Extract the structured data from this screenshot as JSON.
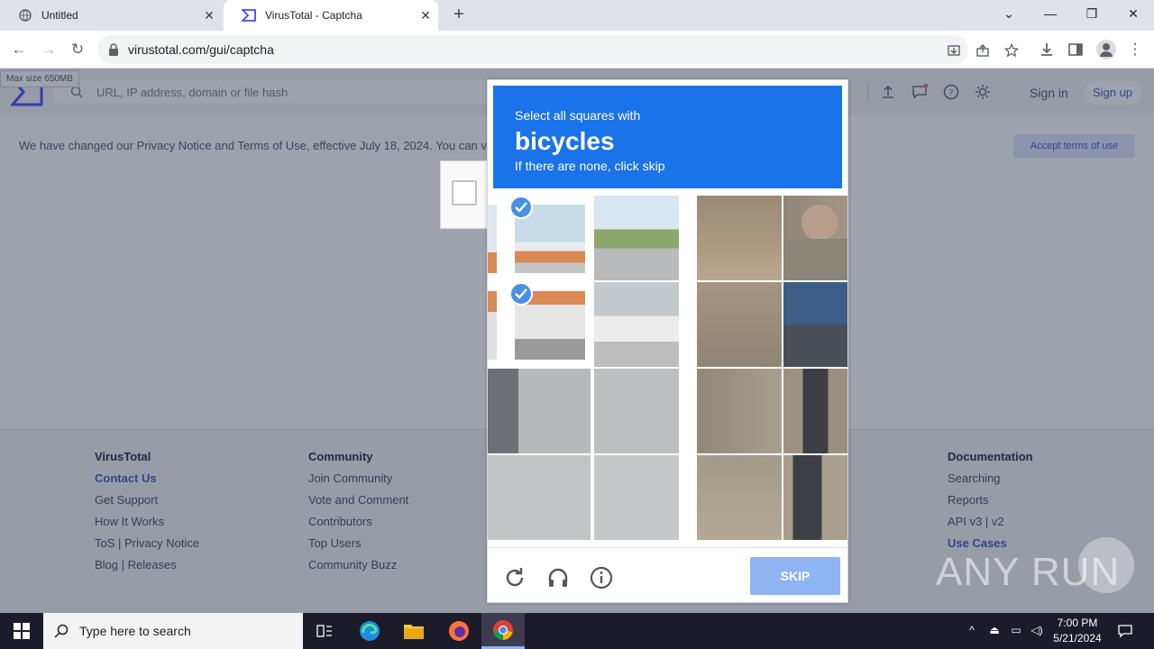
{
  "browser": {
    "tabs": [
      {
        "title": "Untitled",
        "active": false
      },
      {
        "title": "VirusTotal - Captcha",
        "active": true
      }
    ],
    "url": "virustotal.com/gui/captcha"
  },
  "page": {
    "max_size_tooltip": "Max size 650MB",
    "search_placeholder": "URL, IP address, domain or file hash",
    "sign_in": "Sign in",
    "sign_up": "Sign up",
    "banner_text": "We have changed our Privacy Notice and Terms of Use, effective July 18, 2024. You can v",
    "accept_terms": "Accept terms of use",
    "footer": {
      "col1": {
        "title": "VirusTotal",
        "links": [
          "Contact Us",
          "Get Support",
          "How It Works",
          "ToS | Privacy Notice",
          "Blog | Releases"
        ]
      },
      "col2": {
        "title": "Community",
        "links": [
          "Join Community",
          "Vote and Comment",
          "Contributors",
          "Top Users",
          "Community Buzz"
        ]
      },
      "col5": {
        "title": "Documentation",
        "links": [
          "Searching",
          "Reports",
          "API v3 | v2",
          "Use Cases"
        ]
      }
    }
  },
  "captcha": {
    "line1": "Select all squares with",
    "keyword": "bicycles",
    "line3": "If there are none, click skip",
    "skip_label": "SKIP",
    "selected_tiles": [
      0,
      3
    ]
  },
  "watermark": "ANY RUN",
  "taskbar": {
    "search_placeholder": "Type here to search",
    "time": "7:00 PM",
    "date": "5/21/2024"
  },
  "colors": {
    "captcha_header": "#1a73e8",
    "skip_button": "#8fb4f2",
    "check_badge": "#4a90e2"
  }
}
